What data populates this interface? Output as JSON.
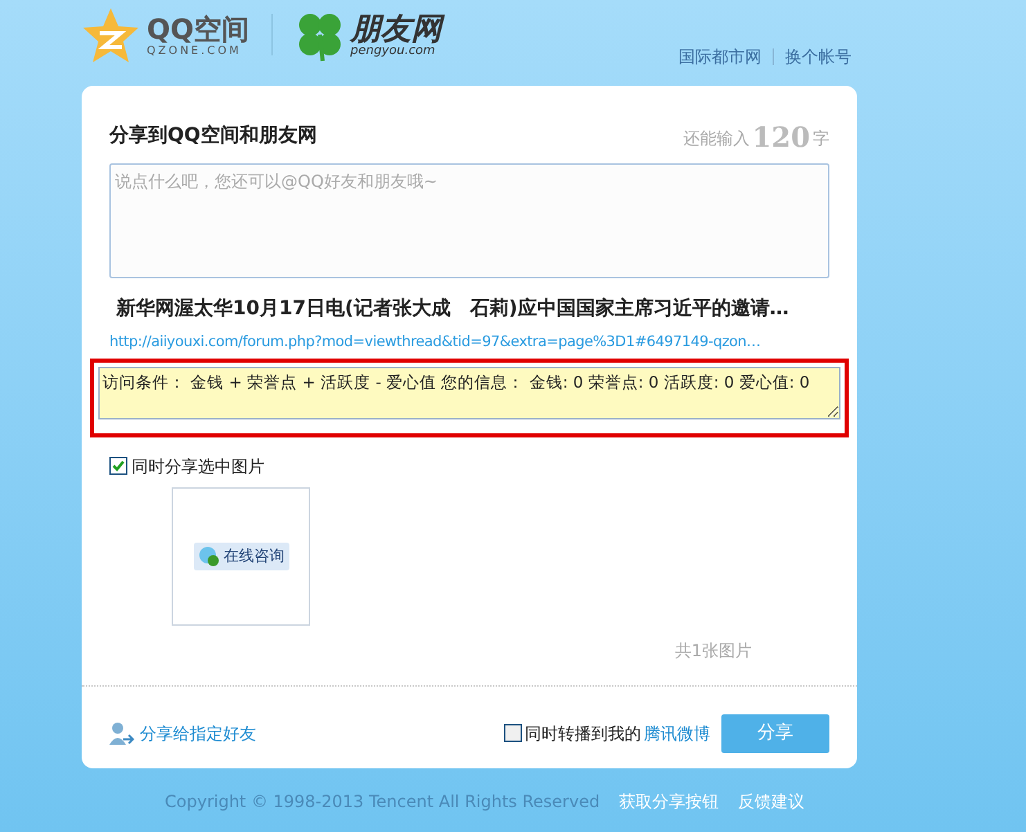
{
  "header": {
    "qzone_logo": {
      "name": "QQ空间",
      "sub": "QZONE.COM"
    },
    "pengyou_logo": {
      "name": "朋友网",
      "sub": "pengyou.com"
    },
    "links": [
      "国际都市网",
      "换个帐号"
    ]
  },
  "card": {
    "title": "分享到QQ空间和朋友网",
    "counter": {
      "prefix": "还能输入",
      "count": "120",
      "suffix": "字"
    },
    "message": {
      "placeholder": "说点什么吧，您还可以@QQ好友和朋友哦~"
    },
    "article_title": "新华网渥太华10月17日电(记者张大成　石莉)应中国国家主席习近平的邀请…",
    "url": "http://aiiyouxi.com/forum.php?mod=viewthread&tid=97&extra=page%3D1#6497149-qzon…",
    "description": {
      "value": "访问条件： 金钱 + 荣誉点 + 活跃度 - 爱心值 您的信息： 金钱: 0 荣誉点: 0 活跃度: 0 爱心值: 0",
      "highlighted": true
    },
    "share_images": {
      "label": "同时分享选中图片",
      "checked": true
    },
    "thumbnail": {
      "button_text": "在线咨询"
    },
    "image_count": "共1张图片",
    "share_friends": "分享给指定好友",
    "weibo": {
      "label": "同时转播到我的",
      "link": "腾讯微博",
      "checked": false
    },
    "share_button": "分享"
  },
  "footer": {
    "copyright": "Copyright © 1998-2013 Tencent All Rights Reserved",
    "links": [
      "获取分享按钮",
      "反馈建议"
    ]
  }
}
